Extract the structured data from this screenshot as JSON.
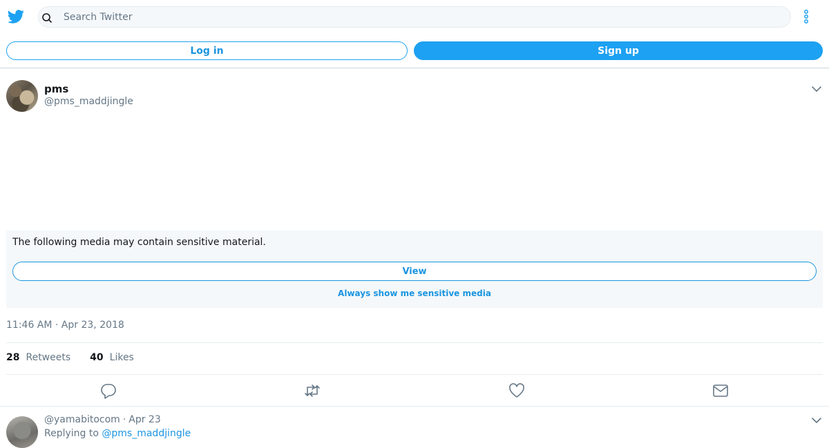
{
  "topbar": {
    "search_placeholder": "Search Twitter"
  },
  "auth": {
    "login_label": "Log in",
    "signup_label": "Sign up"
  },
  "tweet": {
    "author_name": "pms",
    "author_handle": "@pms_maddjingle",
    "sensitive_notice": "The following media may contain sensitive material.",
    "view_label": "View",
    "always_show_label": "Always show me sensitive media",
    "timestamp": "11:46 AM · Apr 23, 2018",
    "retweets_count": "28",
    "retweets_label": "Retweets",
    "likes_count": "40",
    "likes_label": "Likes"
  },
  "reply": {
    "handle": "@yamabitocom",
    "date": "Apr 23",
    "separator": "·",
    "replying_prefix": "Replying to",
    "replying_handle": "@pms_maddjingle"
  },
  "icons": {
    "logo": "twitter-bird-icon",
    "search": "search-icon",
    "more": "more-vertical-icon",
    "caret": "chevron-down-icon",
    "reply": "reply-icon",
    "retweet": "retweet-icon",
    "like": "heart-icon",
    "message": "envelope-icon"
  },
  "colors": {
    "brand": "#1da1f2",
    "link": "#1b95e0",
    "muted": "#657786",
    "divider": "#e6ecf0"
  }
}
